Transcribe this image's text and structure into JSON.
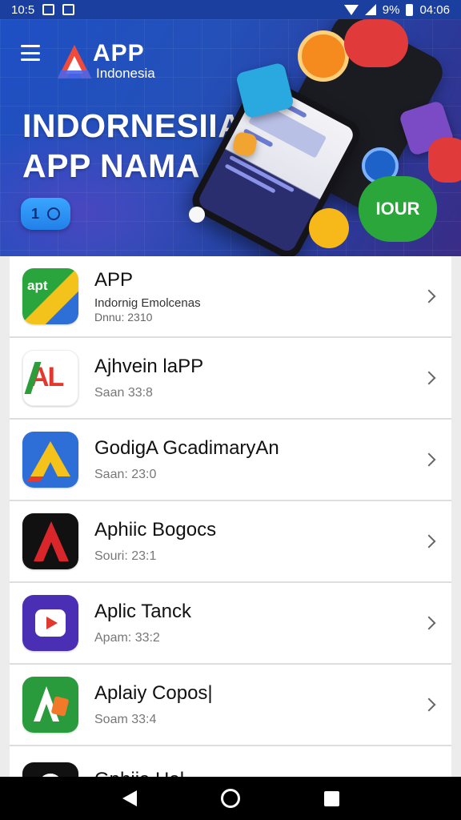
{
  "status_bar": {
    "time_left": "10:5",
    "battery": "9%",
    "time_right": "04:06"
  },
  "banner": {
    "logo_title": "APP",
    "logo_subtitle": "Indonesia",
    "headline_line1": "INDORNESIIA",
    "headline_line2": "APP NAMA",
    "action_label": "1",
    "badge_text": "IOUR"
  },
  "apps": [
    {
      "name": "APP",
      "subtitle": "Indornig Emolcenas",
      "detail": "Dnnu: 2310",
      "icon": "apt-icon",
      "icon_text": "apt"
    },
    {
      "name": "Ajhvein laPP",
      "subtitle": "Saan 33:8",
      "icon": "al-icon",
      "icon_text": "AL"
    },
    {
      "name": "GodigA GcadimaryAn",
      "subtitle": "Saan: 23:0",
      "icon": "triangle-a-icon"
    },
    {
      "name": "Aphiic Bogocs",
      "subtitle": "Souri: 23:1",
      "icon": "red-a-icon"
    },
    {
      "name": "Aplic Tanck",
      "subtitle": "Apam: 33:2",
      "icon": "play-d-icon"
    },
    {
      "name": "Aplaiy Copos|",
      "subtitle": "Soam 33:4",
      "icon": "green-a-icon"
    },
    {
      "name": "Gphiia Hal",
      "subtitle": "",
      "icon": "dark-circle-icon"
    }
  ],
  "colors": {
    "banner_start": "#1e4fc4",
    "banner_end": "#3a2c86",
    "accent_blue": "#2280e8"
  }
}
